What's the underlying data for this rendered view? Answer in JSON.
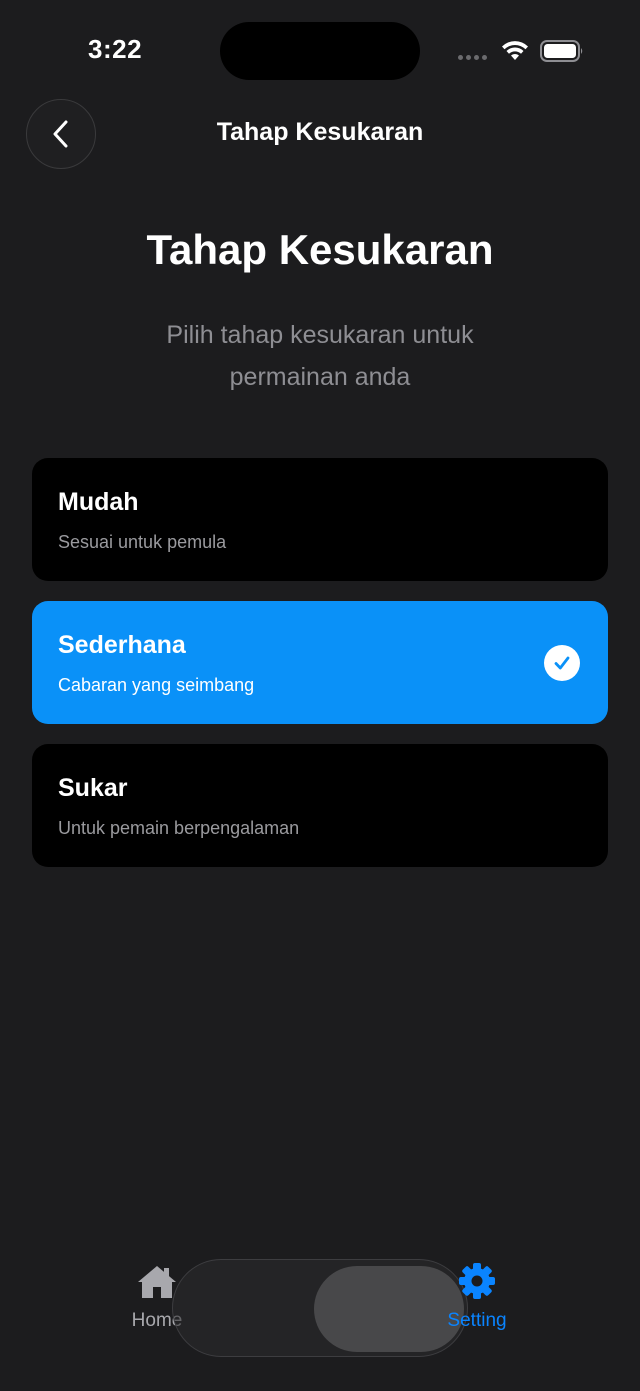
{
  "status_bar": {
    "time": "3:22"
  },
  "nav": {
    "title": "Tahap Kesukaran",
    "back_icon": "chevron-left-icon"
  },
  "header": {
    "title": "Tahap Kesukaran",
    "subtitle": "Pilih tahap kesukaran untuk permainan anda"
  },
  "options": [
    {
      "title": "Mudah",
      "description": "Sesuai untuk pemula",
      "selected": false
    },
    {
      "title": "Sederhana",
      "description": "Cabaran yang seimbang",
      "selected": true
    },
    {
      "title": "Sukar",
      "description": "Untuk pemain berpengalaman",
      "selected": false
    }
  ],
  "tab_bar": {
    "items": [
      {
        "label": "Home",
        "icon": "house-icon",
        "active": false
      },
      {
        "label": "Setting",
        "icon": "gear-icon",
        "active": true
      }
    ]
  },
  "colors": {
    "background": "#1c1c1e",
    "card": "#000000",
    "accent": "#0a91f8",
    "tab_active": "#0a84ff"
  }
}
